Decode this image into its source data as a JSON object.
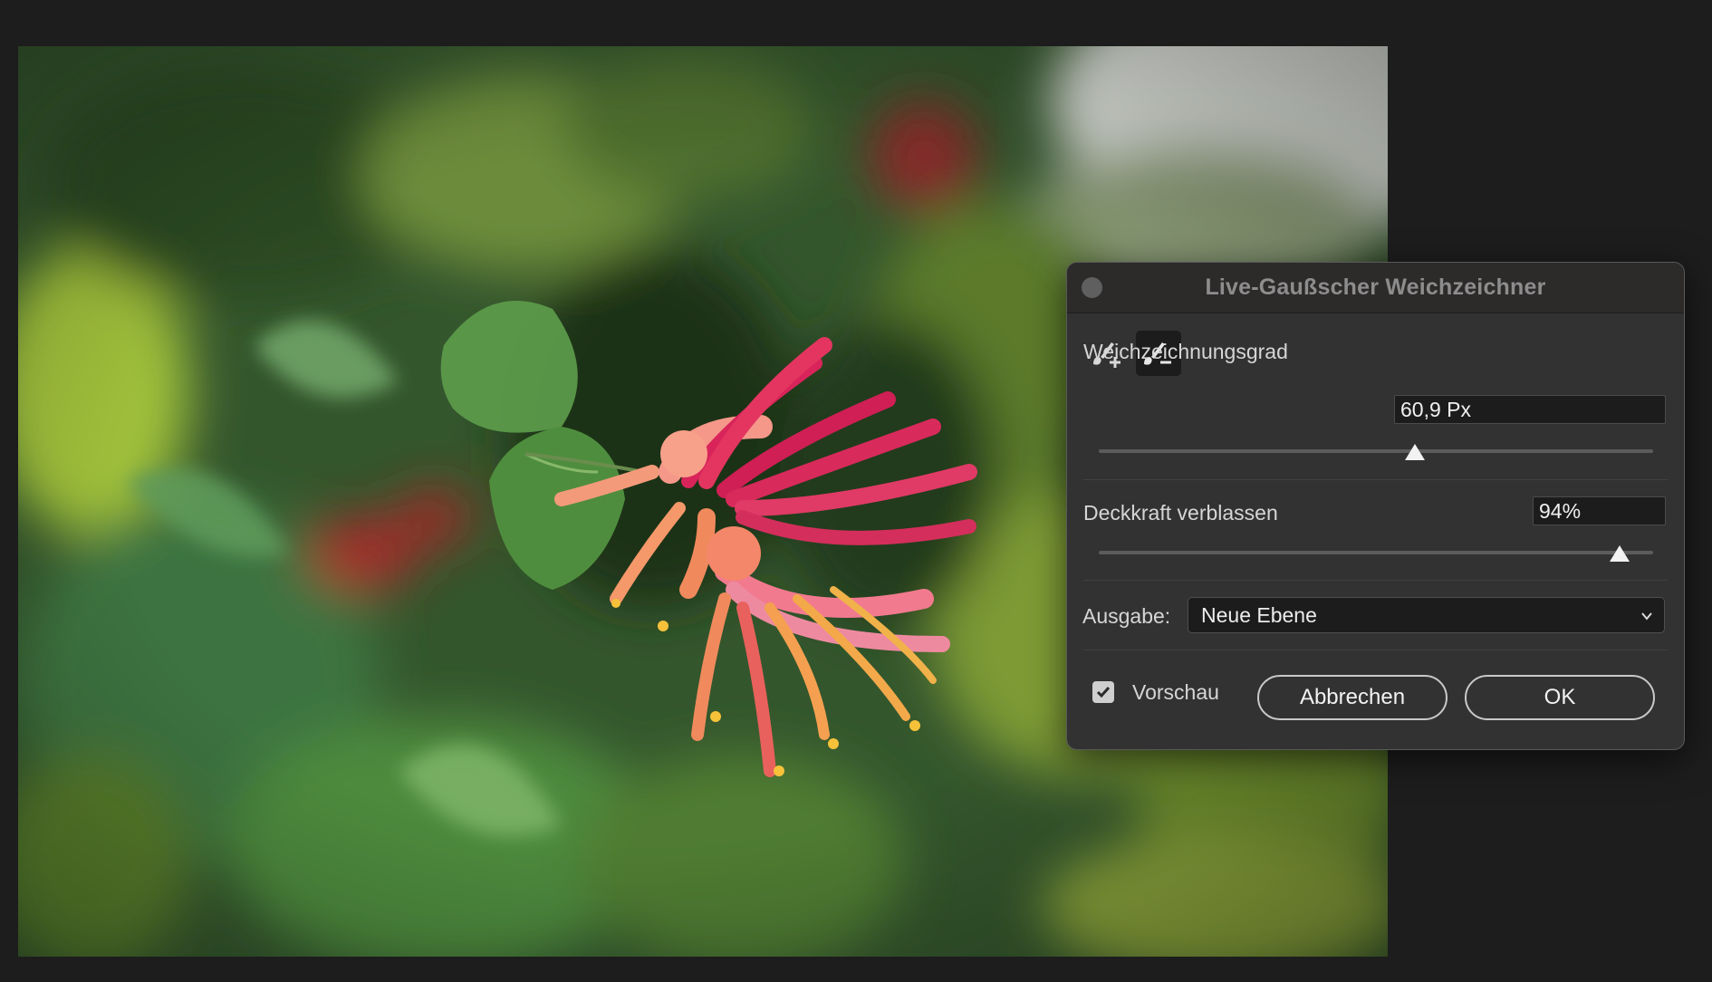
{
  "dialog": {
    "title": "Live-Gaußscher Weichzeichner",
    "tools": [
      {
        "name": "add-brush-icon",
        "active": false
      },
      {
        "name": "subtract-brush-icon",
        "active": true
      }
    ],
    "blur": {
      "label": "Weichzeichnungsgrad",
      "value": "60,9 Px",
      "slider_fraction": 0.57
    },
    "fade": {
      "label": "Deckkraft verblassen",
      "value": "94%",
      "slider_fraction": 0.94
    },
    "output": {
      "label": "Ausgabe:",
      "selected": "Neue Ebene"
    },
    "preview": {
      "label": "Vorschau",
      "checked": true
    },
    "cancel_label": "Abbrechen",
    "ok_label": "OK"
  },
  "colors": {
    "dialog_bg": "#323232",
    "titlebar_bg": "#2d2a2a",
    "photo_green": "#3f6b35",
    "flower_pink": "#e23d6a",
    "flower_orange": "#f08a5d"
  }
}
